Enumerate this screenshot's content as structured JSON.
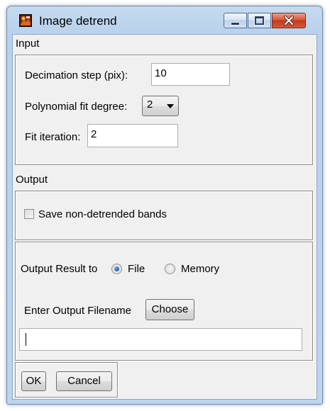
{
  "window": {
    "title": "Image detrend",
    "icon": "app-icon",
    "controls": [
      "minimize-icon",
      "maximize-icon",
      "close-icon"
    ]
  },
  "input": {
    "section_label": "Input",
    "decimation_label": "Decimation step (pix):",
    "decimation_value": "10",
    "polynomial_label": "Polynomial fit degree:",
    "polynomial_value": "2",
    "iteration_label": "Fit iteration:",
    "iteration_value": "2"
  },
  "output": {
    "section_label": "Output",
    "save_bands_label": "Save non-detrended bands",
    "save_bands_checked": false,
    "result_to_label": "Output Result to",
    "option_file": "File",
    "option_memory": "Memory",
    "selected_option": "File",
    "filename_label": "Enter Output Filename",
    "choose_label": "Choose",
    "filename_value": ""
  },
  "actions": {
    "ok_label": "OK",
    "cancel_label": "Cancel"
  },
  "colors": {
    "frame": "#bcd4ee",
    "client": "#f0f0f0",
    "close_button": "#c3391d",
    "radio_selected": "#1a5fb0"
  }
}
